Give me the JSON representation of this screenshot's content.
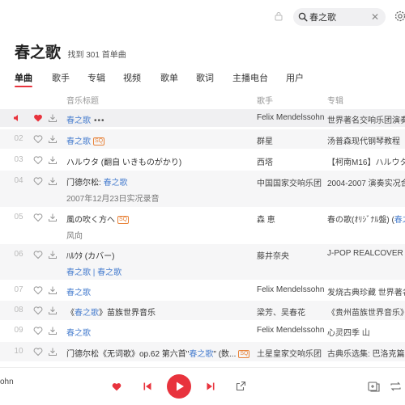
{
  "search": {
    "value": "春之歌",
    "clear_icon": "close-icon"
  },
  "header": {
    "title": "春之歌",
    "subtitle": "找到 301 首单曲"
  },
  "tabs": [
    {
      "label": "单曲",
      "active": true
    },
    {
      "label": "歌手"
    },
    {
      "label": "专辑"
    },
    {
      "label": "视频"
    },
    {
      "label": "歌单"
    },
    {
      "label": "歌词"
    },
    {
      "label": "主播电台"
    },
    {
      "label": "用户"
    }
  ],
  "columns": {
    "title": "音乐标题",
    "artist": "歌手",
    "album": "专辑"
  },
  "rows": [
    {
      "num": "",
      "playing": true,
      "liked": true,
      "title": "春之歌",
      "dots": "•••",
      "artist": "Felix Mendelssohn",
      "album": "世界著名交响乐团演奏的"
    },
    {
      "num": "02",
      "title": "春之歌",
      "sq": "SQ",
      "artist": "群星",
      "album": "汤普森现代钢琴教程"
    },
    {
      "num": "03",
      "title": "ハルウタ (翻自 いきものがかり)",
      "artist": "西塔",
      "album": "【柯南M16】ハルウタ"
    },
    {
      "num": "04",
      "title_pre": "门德尔松: ",
      "title": "春之歌",
      "sub": "2007年12月23日实况录音",
      "artist": "中国国家交响乐团",
      "album": "2004-2007 演奏实况合"
    },
    {
      "num": "05",
      "title": "風の吹く方へ",
      "sq": "SQ",
      "sub": "风向",
      "artist": "森 恵",
      "album_pre": "春の歌(ｵﾘｼﾞﾅﾙ盤) (",
      "album_blue": "春之"
    },
    {
      "num": "06",
      "title": "ﾊﾙｳﾀ (カバー)",
      "sub_blue": "春之歌 | 春之歌",
      "artist": "藤井奈央",
      "album": "J-POP REALCOVER VOL"
    },
    {
      "num": "07",
      "title": "春之歌",
      "artist": "Felix Mendelssohn",
      "album": "发烧古典珍藏 世界著名"
    },
    {
      "num": "08",
      "title_pre": "《",
      "title": "春之歌",
      "title_post": "》苗族世界音乐",
      "artist": "梁芳、吴春花",
      "album": "《贵州苗族世界音乐》"
    },
    {
      "num": "09",
      "title": "春之歌",
      "artist": "Felix Mendelssohn",
      "album": "心灵四季 山"
    },
    {
      "num": "10",
      "title_pre": "门德尔松《无词歌》op.62 第六首\"",
      "title": "春之歌",
      "title_post": "\" (数...",
      "sq": "SQ",
      "artist": "土星皇家交响乐团",
      "album": "古典乐选集: 巴洛克篇"
    }
  ],
  "player": {
    "left_text": "ohn"
  },
  "colors": {
    "accent": "#e8333d",
    "link": "#4a7fcf",
    "sq": "#e8833a"
  }
}
